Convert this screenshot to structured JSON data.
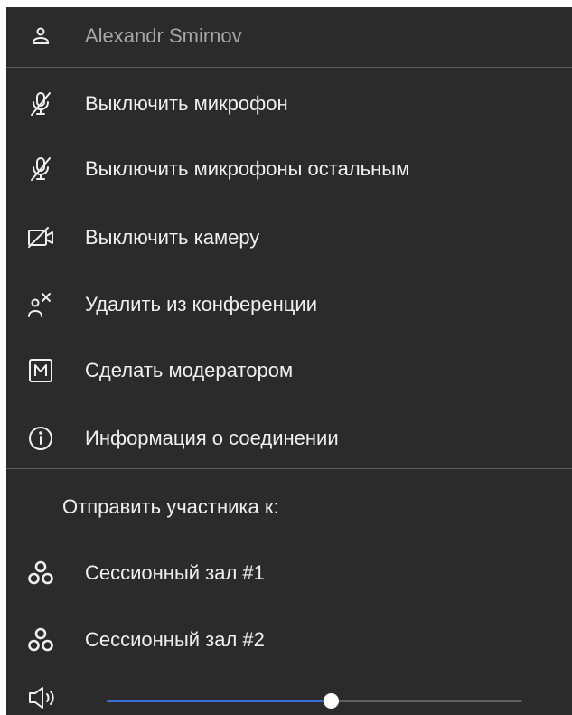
{
  "menu": {
    "user": {
      "name": "Alexandr Smirnov",
      "icon": "user-icon"
    },
    "items": [
      {
        "label": "Выключить микрофон",
        "icon": "mic-off-icon"
      },
      {
        "label": "Выключить микрофоны остальным",
        "icon": "mic-off-all-icon"
      },
      {
        "label": "Выключить камеру",
        "icon": "camera-off-icon"
      },
      {
        "label": "Удалить из конференции",
        "icon": "remove-user-icon"
      },
      {
        "label": "Сделать модератором",
        "icon": "moderator-icon"
      },
      {
        "label": "Информация о соединении",
        "icon": "info-icon"
      }
    ],
    "send_section": {
      "title": "Отправить участника к:",
      "rooms": [
        {
          "label": "Сессионный зал #1",
          "icon": "breakout-room-icon"
        },
        {
          "label": "Сессионный зал #2",
          "icon": "breakout-room-icon"
        }
      ]
    },
    "volume": {
      "icon": "volume-icon",
      "level": 0.54
    }
  },
  "colors": {
    "background": "#2b2b2b",
    "text": "#efefef",
    "muted_text": "#a6a6a6",
    "divider": "#5a5a5a",
    "accent": "#3f6fd6"
  }
}
